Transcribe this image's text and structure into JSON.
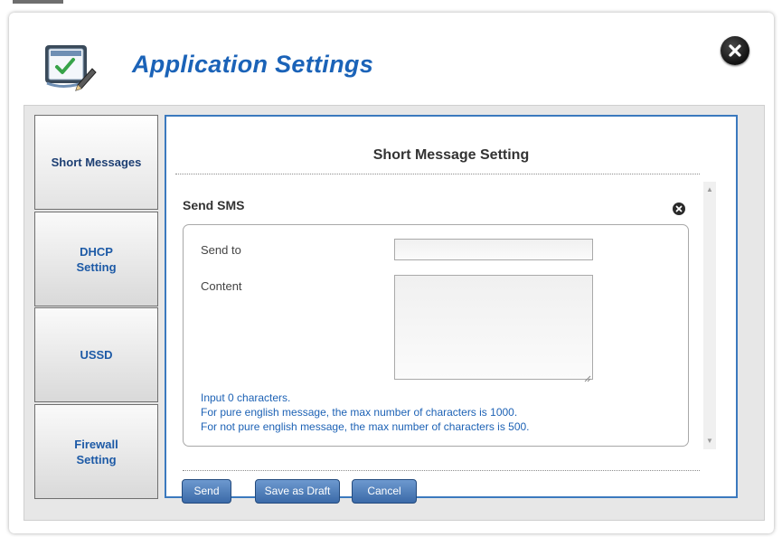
{
  "header": {
    "title": "Application Settings",
    "icon": "checklist-pencil-icon",
    "close_icon": "close-icon"
  },
  "sidebar": {
    "items": [
      {
        "label": "Short Messages",
        "active": true
      },
      {
        "label": "DHCP\nSetting",
        "active": false
      },
      {
        "label": "USSD",
        "active": false
      },
      {
        "label": "Firewall\nSetting",
        "active": false
      }
    ]
  },
  "panel": {
    "title": "Short Message Setting",
    "section_title": "Send SMS",
    "form": {
      "send_to_label": "Send to",
      "send_to_value": "",
      "content_label": "Content",
      "content_value": ""
    },
    "info": {
      "count_line": "Input 0 characters.",
      "english_line": "For pure english message, the max number of characters is 1000.",
      "non_english_line": "For not pure english message, the max number of characters is 500."
    }
  },
  "actions": {
    "send": "Send",
    "save_draft": "Save as Draft",
    "cancel": "Cancel"
  },
  "colors": {
    "accent": "#1b63b8",
    "panel_border": "#3b79be",
    "button": "#4a78b5"
  }
}
